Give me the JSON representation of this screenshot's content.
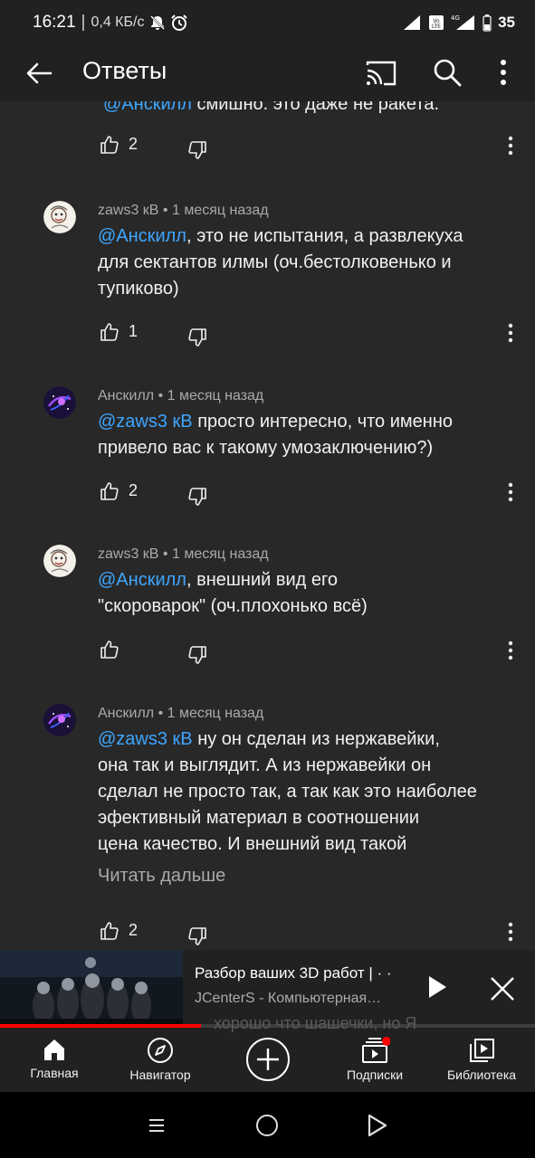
{
  "status_bar": {
    "time": "16:21",
    "speed": "0,4 КБ/с",
    "network": "4G",
    "battery": "35"
  },
  "app_bar": {
    "title": "Ответы"
  },
  "partial_comment": {
    "mention": "@Анскилл",
    "text": " смишно. это даже не ракета.",
    "like_count": "2"
  },
  "comments": [
    {
      "author": "zaws3 кВ",
      "time": "1 месяц назад",
      "mention": "@Анскилл",
      "lines": [
        ", это не испытания, а развлекуха",
        "для сектантов илмы (оч.бестолковенько и",
        "тупиково)"
      ],
      "like_count": "1"
    },
    {
      "author": "Анскилл",
      "time": "1 месяц назад",
      "mention": "@zaws3 кВ",
      "lines": [
        " просто интересно, что именно",
        "привело вас к такому умозаключению?)"
      ],
      "like_count": "2"
    },
    {
      "author": "zaws3 кВ",
      "time": "1 месяц назад",
      "mention": "@Анскилл",
      "lines": [
        ", внешний вид его",
        "\"скороварок\" (оч.плохонько всё)"
      ],
      "like_count": ""
    },
    {
      "author": "Анскилл",
      "time": "1 месяц назад",
      "mention": "@zaws3 кВ",
      "lines": [
        " ну он сделан из нержавейки,",
        "она так и выглядит. А из нержавейки он",
        "сделал не просто так, а так как это наиболее",
        "эфективный материал в соотношении",
        "цена качество. И внешний вид такой"
      ],
      "read_more": "Читать дальше",
      "like_count": "2"
    }
  ],
  "mini_player": {
    "title": "Разбор ваших 3D работ | · ·",
    "channel": "JCenterS - Компьютерная…",
    "progress": 0.375
  },
  "behind_text": "хорошо что шашечки, но Я",
  "bottom_nav": [
    {
      "label": "Главная",
      "icon": "home-icon"
    },
    {
      "label": "Навигатор",
      "icon": "compass-icon"
    },
    {
      "label": "",
      "icon": "create-plus-icon"
    },
    {
      "label": "Подписки",
      "icon": "subscriptions-icon"
    },
    {
      "label": "Библиотека",
      "icon": "library-icon"
    }
  ],
  "colors": {
    "background": "#282828",
    "bar": "#212121",
    "mention": "#3ea6ff",
    "secondary_text": "#aaaaaa",
    "progress": "#ff0000",
    "notification_dot": "#ff0000"
  }
}
